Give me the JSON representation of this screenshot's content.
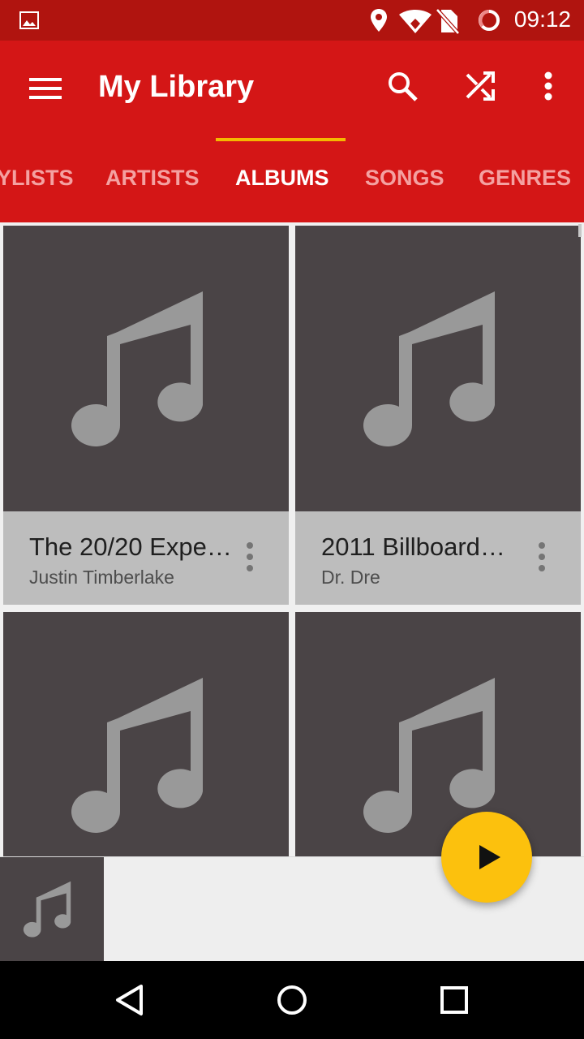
{
  "status_bar": {
    "time": "09:12",
    "icons": [
      "image-notification-icon",
      "location-icon",
      "wifi-icon",
      "no-sim-icon",
      "battery-ring-icon"
    ]
  },
  "app_bar": {
    "title": "My Library",
    "icons": [
      "menu-icon",
      "search-icon",
      "shuffle-icon",
      "more-vert-icon"
    ]
  },
  "tabs": [
    {
      "label": "YLISTS",
      "active": false
    },
    {
      "label": "ARTISTS",
      "active": false
    },
    {
      "label": "ALBUMS",
      "active": true
    },
    {
      "label": "SONGS",
      "active": false
    },
    {
      "label": "GENRES",
      "active": false
    }
  ],
  "albums": [
    {
      "title": "The 20/20 Expe…",
      "artist": "Justin Timberlake"
    },
    {
      "title": "2011 Billboard…",
      "artist": "Dr. Dre"
    },
    {
      "title": "",
      "artist": ""
    },
    {
      "title": "",
      "artist": ""
    }
  ],
  "fab": {
    "icon": "play-icon"
  },
  "mini_player": {
    "icon": "music-note-icon"
  },
  "nav_bar": {
    "icons": [
      "back-icon",
      "home-icon",
      "recents-icon"
    ]
  },
  "colors": {
    "status_bar": "#b0140f",
    "app_bar": "#d41616",
    "tab_indicator": "#f5b800",
    "album_art_bg": "#4a4446",
    "album_info_bg": "#bdbdbd",
    "fab": "#fcc10d"
  }
}
